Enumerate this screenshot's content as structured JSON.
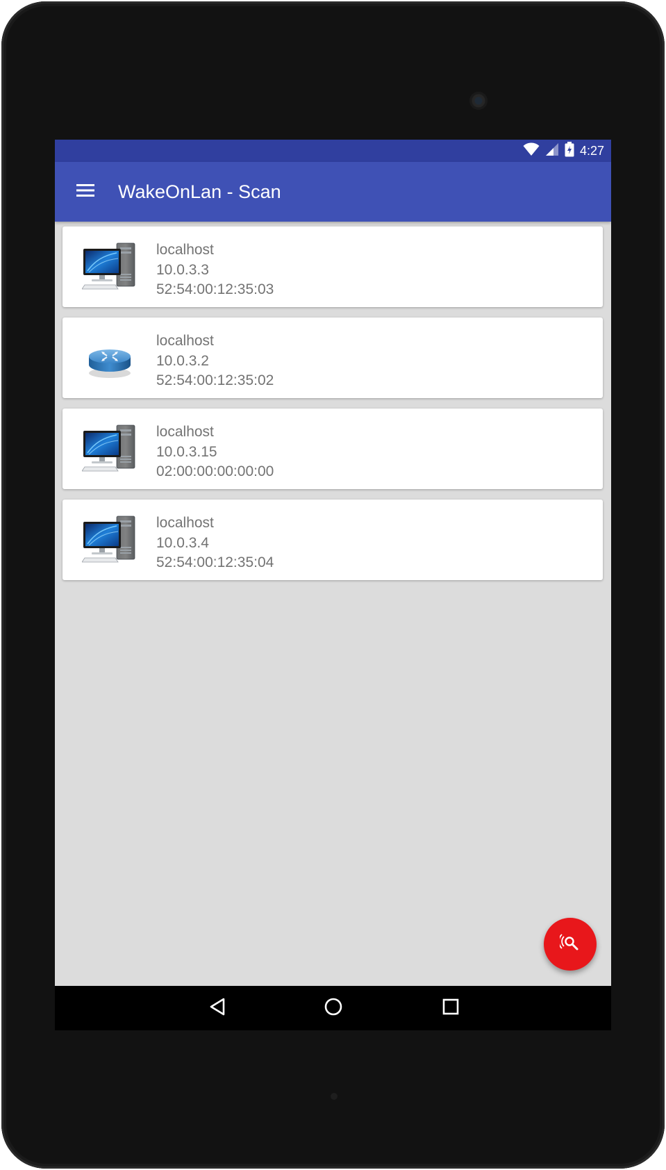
{
  "status_bar": {
    "time": "4:27",
    "icons": [
      "wifi-icon",
      "signal-icon",
      "battery-charging-icon"
    ]
  },
  "toolbar": {
    "menu_icon": "hamburger-menu-icon",
    "title": "WakeOnLan - Scan"
  },
  "devices": [
    {
      "icon": "desktop-computer-icon",
      "hostname": "localhost",
      "ip": "10.0.3.3",
      "mac": "52:54:00:12:35:03"
    },
    {
      "icon": "router-icon",
      "hostname": "localhost",
      "ip": "10.0.3.2",
      "mac": "52:54:00:12:35:02"
    },
    {
      "icon": "desktop-computer-icon",
      "hostname": "localhost",
      "ip": "10.0.3.15",
      "mac": "02:00:00:00:00:00"
    },
    {
      "icon": "desktop-computer-icon",
      "hostname": "localhost",
      "ip": "10.0.3.4",
      "mac": "52:54:00:12:35:04"
    }
  ],
  "fab": {
    "icon": "network-scan-icon"
  },
  "nav_bar": {
    "icons": [
      "back-icon",
      "home-icon",
      "recents-icon"
    ]
  },
  "colors": {
    "status_bar": "#303f9f",
    "toolbar": "#3f51b5",
    "background": "#dcdcdc",
    "card": "#ffffff",
    "text": "#737373",
    "fab": "#e8171b",
    "nav_bar": "#000000"
  }
}
